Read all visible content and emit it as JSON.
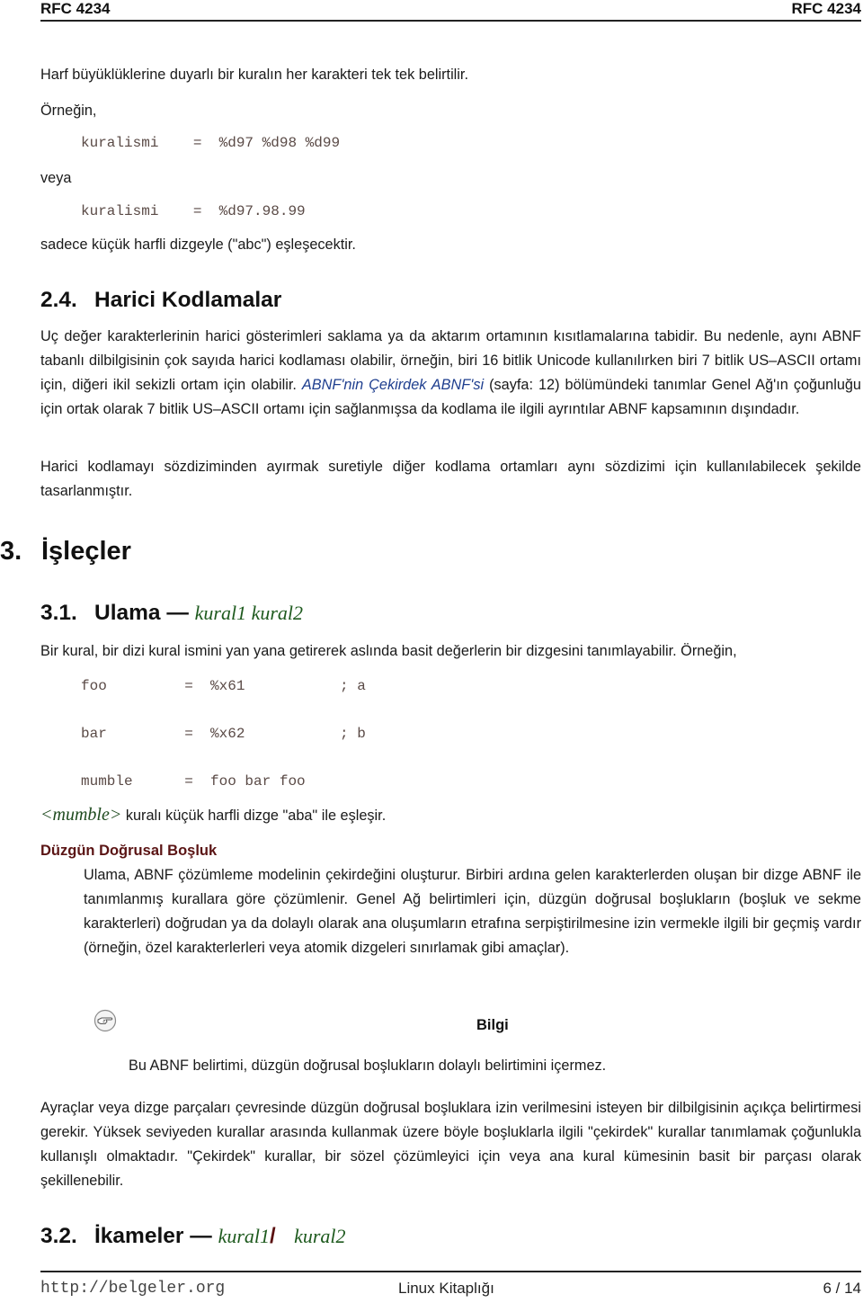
{
  "header": {
    "left": "RFC 4234",
    "right": "RFC 4234"
  },
  "intro": {
    "p1": "Harf büyüklüklerine duyarlı bir kuralın her karakteri tek tek belirtilir.",
    "p2": "Örneğin,",
    "code1": "kuralismi    =  %d97 %d98 %d99",
    "p3": "veya",
    "code2": "kuralismi    =  %d97.98.99",
    "p4": "sadece küçük harfli dizgeyle (\"abc\") eşleşecektir."
  },
  "section_2_4": {
    "number": "2.4.",
    "title": "Harici Kodlamalar",
    "para1_before_link": "Uç değer karakterlerinin harici gösterimleri saklama ya da aktarım ortamının kısıtlamalarına tabidir. Bu nedenle, aynı ABNF tabanlı dilbilgisinin çok sayıda harici kodlaması olabilir, örneğin, biri 16 bitlik Unicode kullanılırken biri 7 bitlik US–ASCII ortamı için, diğeri ikil sekizli ortam için olabilir. ",
    "link_text": "ABNF'nin Çekirdek ABNF'si",
    "para1_after_link": " (sayfa: 12) bölümündeki tanımlar Genel Ağ'ın çoğunluğu için ortak olarak 7 bitlik US–ASCII ortamı için sağlanmışsa da kodlama ile ilgili ayrıntılar ABNF kapsamının dışındadır.",
    "para2": "Harici kodlamayı sözdiziminden ayırmak suretiyle diğer kodlama ortamları aynı sözdizimi için kullanılabilecek şekilde tasarlanmıştır."
  },
  "section_3": {
    "number": "3.",
    "title": "İşleçler"
  },
  "section_3_1": {
    "number": "3.1.",
    "title": "Ulama —",
    "rule_text": "kural1 kural2",
    "para": "Bir kural, bir dizi kural ismini yan yana getirerek aslında basit değerlerin bir dizgesini tanımlayabilir. Örneğin,",
    "code_lines": [
      "foo         =  %x61           ; a",
      "bar         =  %x62           ; b",
      "mumble      =  foo bar foo"
    ],
    "mumble_tag": "<mumble>",
    "mumble_text": " kuralı küçük harfli dizge \"aba\" ile eşleşir."
  },
  "definition": {
    "term": "Düzgün Doğrusal Boşluk",
    "text": "Ulama, ABNF çözümleme modelinin çekirdeğini oluşturur. Birbiri ardına gelen karakterlerden oluşan bir dizge ABNF ile tanımlanmış kurallara göre çözümlenir. Genel Ağ belirtimleri için, düzgün doğrusal boşlukların (boşluk ve sekme karakterleri) doğrudan ya da dolaylı olarak ana oluşumların etrafına serpiştirilmesine izin vermekle ilgili bir geçmiş vardır (örneğin, özel karakterlerleri veya atomik dizgeleri sınırlamak gibi amaçlar)."
  },
  "note": {
    "icon": "pointing-hand-icon",
    "title": "Bilgi",
    "text": "Bu ABNF belirtimi, düzgün doğrusal boşlukların dolaylı belirtimini içermez."
  },
  "closing_para": "Ayraçlar veya dizge parçaları çevresinde düzgün doğrusal boşluklara izin verilmesini isteyen bir dilbilgisinin açıkça belirtirmesi gerekir. Yüksek seviyeden kurallar arasında kullanmak üzere böyle boşluklarla ilgili \"çekirdek\" kurallar tanımlamak çoğunlukla kullanışlı olmaktadır. \"Çekirdek\" kurallar, bir sözel çözümleyici için veya ana kural kümesinin basit bir parçası olarak şekillenebilir.",
  "section_3_2": {
    "number": "3.2.",
    "title": "İkameler —",
    "rule_left": "kural1",
    "slash": "/",
    "rule_right": "kural2"
  },
  "footer": {
    "url": "http://belgeler.org",
    "center": "Linux Kitaplığı",
    "page": "6 / 14"
  },
  "colors": {
    "link": "#1f3f8f",
    "rule_italic": "#1e5a1e",
    "term": "#5a1414",
    "code": "#5a4a46"
  }
}
